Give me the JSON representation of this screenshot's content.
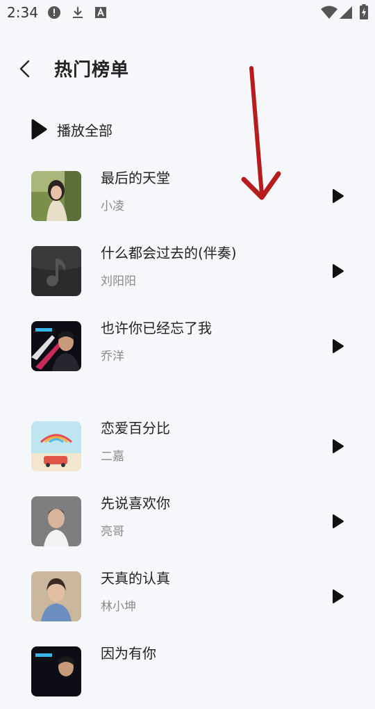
{
  "status": {
    "time": "2:34",
    "icons": [
      "alert-circle-icon",
      "download-icon",
      "font-a-icon",
      "wifi-icon",
      "signal-icon",
      "battery-charging-icon"
    ]
  },
  "header": {
    "title": "热门榜单",
    "back_icon": "chevron-left-icon"
  },
  "play_all": {
    "label": "播放全部",
    "icon": "play-icon"
  },
  "songs": [
    {
      "title": "最后的天堂",
      "artist": "小凌"
    },
    {
      "title": "什么都会过去的(伴奏)",
      "artist": "刘阳阳"
    },
    {
      "title": "也许你已经忘了我",
      "artist": "乔洋"
    },
    {
      "title": "恋爱百分比",
      "artist": "二嘉"
    },
    {
      "title": "先说喜欢你",
      "artist": "亮哥"
    },
    {
      "title": "天真的认真",
      "artist": "林小坤"
    },
    {
      "title": "因为有你",
      "artist": ""
    }
  ],
  "colors": {
    "background": "#f6f7fb",
    "annotation_arrow": "#b71c1c"
  }
}
